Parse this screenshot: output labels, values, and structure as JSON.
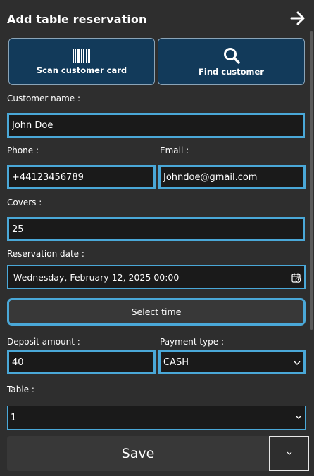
{
  "header": {
    "title": "Add table reservation",
    "back_icon": "arrow-right-icon"
  },
  "actions": {
    "scan_label": "Scan customer card",
    "scan_icon": "barcode-icon",
    "find_label": "Find customer",
    "find_icon": "search-icon"
  },
  "form": {
    "customer_name_label": "Customer name :",
    "customer_name_value": "John Doe",
    "phone_label": "Phone :",
    "phone_value": "+44123456789",
    "email_label": "Email :",
    "email_value": "Johndoe@gmail.com",
    "covers_label": "Covers :",
    "covers_value": "25",
    "reservation_date_label": "Reservation date :",
    "reservation_date_value": "Wednesday, February 12, 2025 00:00",
    "select_time_label": "Select time",
    "deposit_label": "Deposit amount :",
    "deposit_value": "40",
    "payment_type_label": "Payment type :",
    "payment_type_value": "CASH",
    "table_label": "Table :",
    "table_value": "1"
  },
  "footer": {
    "save_label": "Save"
  },
  "colors": {
    "background": "#2e2e2e",
    "accent": "#4aa8d8",
    "action_button": "#123a5a",
    "field": "#1a1a1a"
  }
}
